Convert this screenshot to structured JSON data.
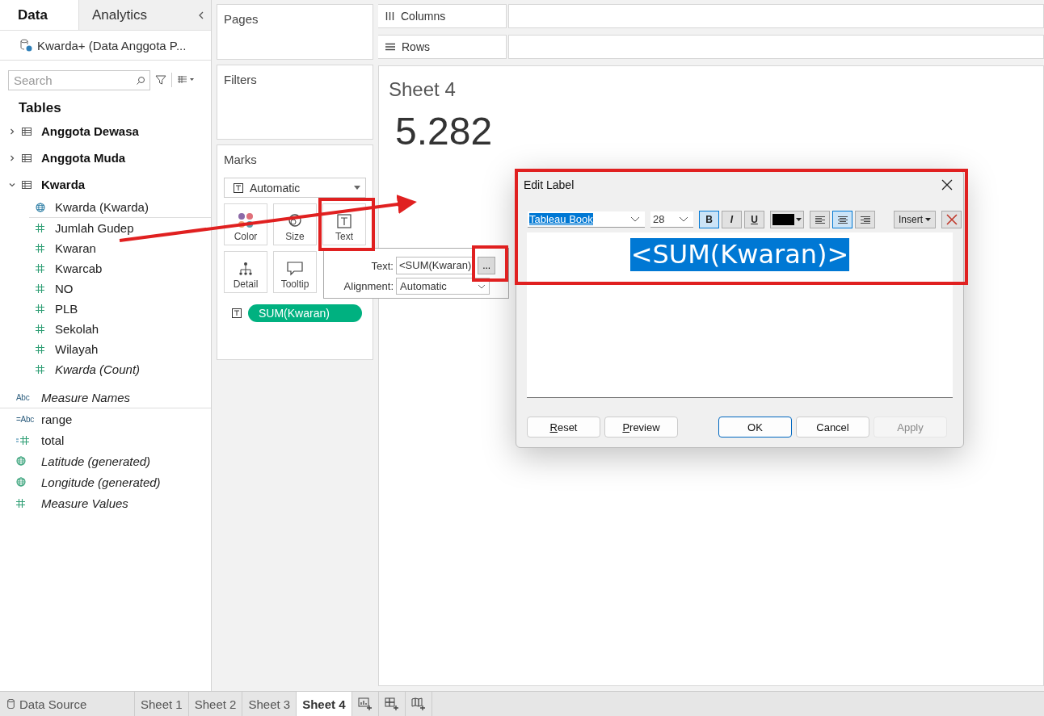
{
  "sidebar": {
    "tabs": [
      {
        "label": "Data",
        "selected": true
      },
      {
        "label": "Analytics",
        "selected": false
      }
    ],
    "datasource": "Kwarda+ (Data Anggota P...",
    "search": {
      "placeholder": "Search"
    },
    "tables_heading": "Tables",
    "tables": [
      {
        "name": "Anggota Dewasa",
        "expanded": false
      },
      {
        "name": "Anggota Muda",
        "expanded": false
      },
      {
        "name": "Kwarda",
        "expanded": true,
        "children": [
          {
            "name": "Kwarda (Kwarda)",
            "kind": "geo",
            "italic": false,
            "divider_after": true
          },
          {
            "name": "Jumlah Gudep",
            "kind": "measure",
            "italic": false,
            "divider_after": false
          },
          {
            "name": "Kwaran",
            "kind": "measure",
            "italic": false,
            "divider_after": false
          },
          {
            "name": "Kwarcab",
            "kind": "measure",
            "italic": false,
            "divider_after": false
          },
          {
            "name": "NO",
            "kind": "measure",
            "italic": false,
            "divider_after": false
          },
          {
            "name": "PLB",
            "kind": "measure",
            "italic": false,
            "divider_after": false
          },
          {
            "name": "Sekolah",
            "kind": "measure",
            "italic": false,
            "divider_after": false
          },
          {
            "name": "Wilayah",
            "kind": "measure",
            "italic": false,
            "divider_after": false
          },
          {
            "name": "Kwarda (Count)",
            "kind": "measure",
            "italic": true,
            "divider_after": false
          }
        ]
      }
    ],
    "fields": [
      {
        "name": "Measure Names",
        "kind": "abc",
        "glyph": "Abc",
        "italic": true,
        "divider_after": true
      },
      {
        "name": "range",
        "kind": "abc",
        "glyph": "=Abc",
        "italic": false,
        "divider_after": false
      },
      {
        "name": "total",
        "kind": "calc_measure",
        "italic": false,
        "divider_after": false
      },
      {
        "name": "Latitude (generated)",
        "kind": "geo",
        "italic": true,
        "divider_after": false
      },
      {
        "name": "Longitude (generated)",
        "kind": "geo",
        "italic": true,
        "divider_after": false
      },
      {
        "name": "Measure Values",
        "kind": "measure",
        "italic": true,
        "divider_after": false
      }
    ]
  },
  "cards": {
    "pages": "Pages",
    "filters": "Filters"
  },
  "shelves": {
    "columns": "Columns",
    "rows": "Rows"
  },
  "marks": {
    "title": "Marks",
    "type": "Automatic",
    "buttons": [
      {
        "label": "Color",
        "kind": "color"
      },
      {
        "label": "Size",
        "kind": "size"
      },
      {
        "label": "Text",
        "kind": "text"
      },
      {
        "label": "Detail",
        "kind": "detail"
      },
      {
        "label": "Tooltip",
        "kind": "tooltip"
      }
    ],
    "pill": "SUM(Kwaran)"
  },
  "text_popup": {
    "text_label": "Text:",
    "text_value": "<SUM(Kwaran)",
    "more": "...",
    "alignment_label": "Alignment:",
    "alignment_value": "Automatic"
  },
  "sheet": {
    "title": "Sheet 4",
    "value": "5.282"
  },
  "dialog": {
    "title": "Edit Label",
    "font": "Tableau Book",
    "size": "28",
    "styles": [
      {
        "label": "B",
        "kind": "bold",
        "on": true
      },
      {
        "label": "I",
        "kind": "italic",
        "on": false
      },
      {
        "label": "U",
        "kind": "underline",
        "on": false
      }
    ],
    "align": [
      {
        "kind": "left",
        "selected": false
      },
      {
        "kind": "center",
        "selected": true
      },
      {
        "kind": "right",
        "selected": false
      }
    ],
    "insert": "Insert",
    "editor_text": "<SUM(Kwaran)>",
    "buttons": [
      {
        "label": "Reset",
        "mnemonic": true,
        "default": false,
        "disabled": false
      },
      {
        "label": "Preview",
        "mnemonic": true,
        "default": false,
        "disabled": false
      },
      {
        "label": "OK",
        "mnemonic": false,
        "default": true,
        "disabled": false
      },
      {
        "label": "Cancel",
        "mnemonic": false,
        "default": false,
        "disabled": false
      },
      {
        "label": "Apply",
        "mnemonic": false,
        "default": false,
        "disabled": true
      }
    ]
  },
  "bottom_tabs": [
    {
      "label": "Data Source",
      "kind": "datasource",
      "selected": false
    },
    {
      "label": "Sheet 1",
      "kind": "sheet",
      "selected": false
    },
    {
      "label": "Sheet 2",
      "kind": "sheet",
      "selected": false
    },
    {
      "label": "Sheet 3",
      "kind": "sheet",
      "selected": false
    },
    {
      "label": "Sheet 4",
      "kind": "sheet",
      "selected": true
    }
  ]
}
